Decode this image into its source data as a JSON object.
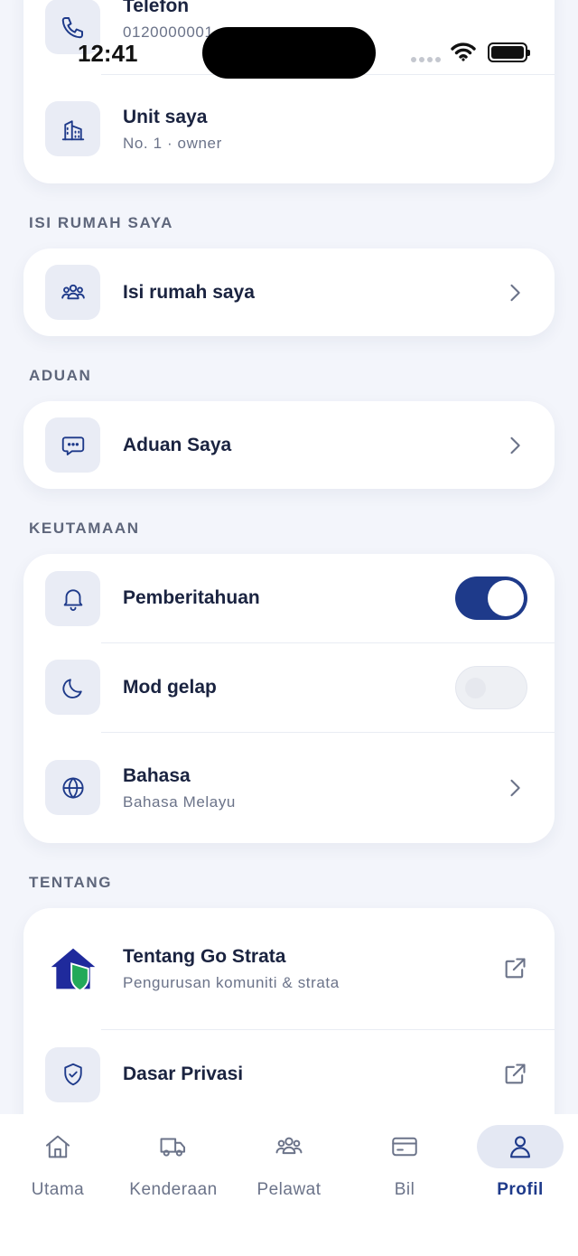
{
  "account": {
    "phone_label": "Telefon",
    "phone_value": "0120000001",
    "unit_label": "Unit saya",
    "unit_value": "No. 1 · owner"
  },
  "sections": {
    "household": {
      "label": "ISI RUMAH SAYA",
      "item": "Isi rumah saya"
    },
    "complaints": {
      "label": "ADUAN",
      "item": "Aduan Saya"
    },
    "preferences": {
      "label": "KEUTAMAAN",
      "notifications": {
        "label": "Pemberitahuan",
        "enabled": true
      },
      "dark_mode": {
        "label": "Mod gelap",
        "enabled": false
      },
      "language": {
        "label": "Bahasa",
        "value": "Bahasa Melayu"
      }
    },
    "about": {
      "label": "TENTANG",
      "about_app": {
        "label": "Tentang Go Strata",
        "subtitle": "Pengurusan komuniti & strata"
      },
      "privacy": {
        "label": "Dasar Privasi"
      }
    }
  },
  "status_bar": {
    "time": "12:41"
  },
  "tabs": [
    {
      "label": "Utama",
      "icon": "home-icon",
      "active": false
    },
    {
      "label": "Kenderaan",
      "icon": "truck-icon",
      "active": false
    },
    {
      "label": "Pelawat",
      "icon": "users-icon",
      "active": false
    },
    {
      "label": "Bil",
      "icon": "credit-card-icon",
      "active": false
    },
    {
      "label": "Profil",
      "icon": "user-icon",
      "active": true
    }
  ],
  "colors": {
    "accent": "#1e3a8a",
    "background": "#f3f5fb",
    "logo_green": "#22a95a",
    "logo_navy": "#1f2a9c"
  }
}
